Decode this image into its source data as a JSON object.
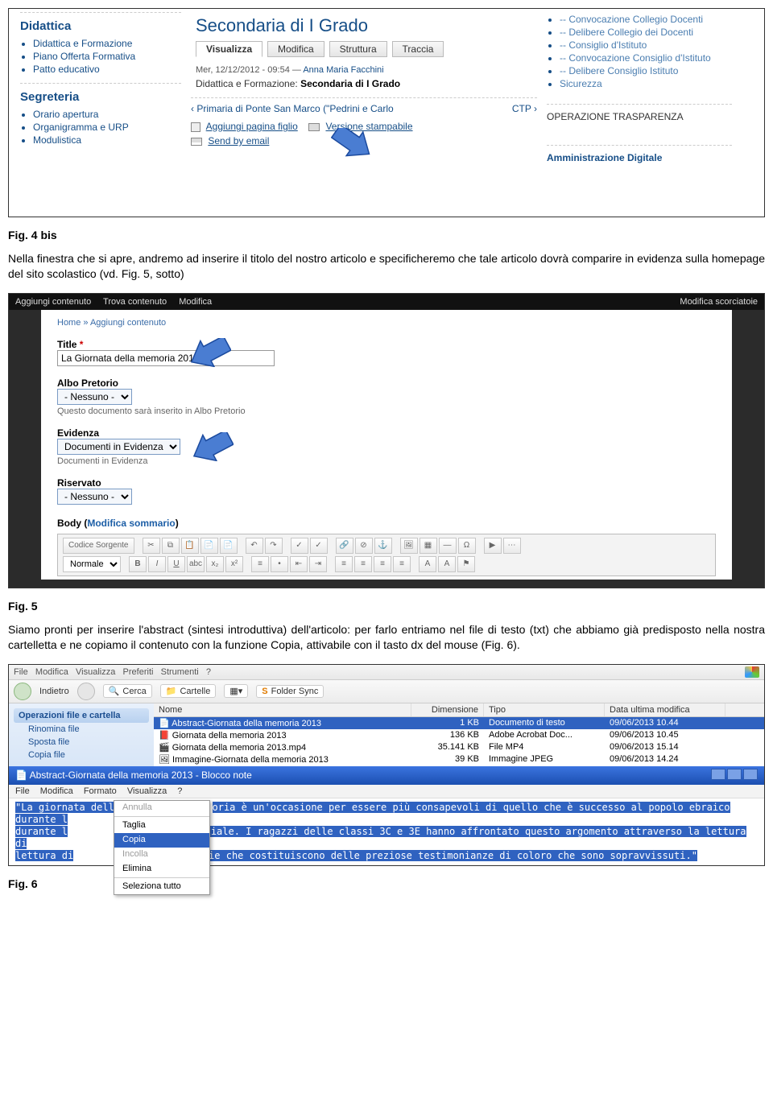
{
  "fig4": {
    "sidebar": {
      "didattica": {
        "heading": "Didattica",
        "items": [
          "Didattica e Formazione",
          "Piano Offerta Formativa",
          "Patto educativo"
        ]
      },
      "segreteria": {
        "heading": "Segreteria",
        "items": [
          "Orario apertura",
          "Organigramma e URP",
          "Modulistica"
        ]
      }
    },
    "main": {
      "title": "Secondaria di I Grado",
      "tabs": [
        "Visualizza",
        "Modifica",
        "Struttura",
        "Traccia"
      ],
      "meta_date": "Mer, 12/12/2012 - 09:54 —",
      "meta_author": "Anna Maria Facchini",
      "bread_prefix": "Didattica e Formazione:",
      "bread_bold": "Secondaria di I Grado",
      "prev": "‹ Primaria di Ponte San Marco (\"Pedrini e Carlo",
      "next": "CTP ›",
      "add_child": "Aggiungi pagina figlio",
      "print": "Versione stampabile",
      "email": "Send by email"
    },
    "right": {
      "items": [
        "-- Convocazione Collegio Docenti",
        "-- Delibere Collegio dei Docenti",
        "-- Consiglio d'Istituto",
        "-- Convocazione Consiglio d'Istituto",
        "-- Delibere Consiglio Istituto",
        "Sicurezza"
      ],
      "box1": "OPERAZIONE TRASPARENZA",
      "box2": "Amministrazione Digitale"
    }
  },
  "para1_label": "Fig. 4 bis",
  "para1": "Nella finestra che si apre, andremo ad inserire il titolo del nostro articolo e specificheremo che tale articolo dovrà comparire in evidenza sulla homepage del sito scolastico (vd. Fig. 5, sotto)",
  "fig5": {
    "topbar": {
      "items": [
        "Aggiungi contenuto",
        "Trova contenuto",
        "Modifica"
      ],
      "right": "Modifica scorciatoie"
    },
    "breadcrumb": "Home » Aggiungi contenuto",
    "labels": {
      "title": "Title",
      "albo": "Albo Pretorio",
      "albo_hint": "Questo documento sarà inserito in Albo Pretorio",
      "evidenza": "Evidenza",
      "evidenza_hint": "Documenti in Evidenza",
      "riservato": "Riservato",
      "body": "Body",
      "body_link": "Modifica sommario"
    },
    "values": {
      "title": "La Giornata della memoria 2013",
      "albo": "- Nessuno -",
      "evidenza": "Documenti in Evidenza",
      "riservato": "- Nessuno -"
    },
    "ck": {
      "src": "Codice Sorgente",
      "format": "Normale"
    }
  },
  "para2_label": "Fig. 5",
  "para2": "Siamo pronti per inserire l'abstract (sintesi introduttiva) dell'articolo: per farlo entriamo nel file di testo (txt) che abbiamo già predisposto nella nostra cartelletta e ne copiamo il contenuto con la funzione Copia, attivabile con il tasto dx del mouse (Fig. 6).",
  "fig6": {
    "menu1": [
      "File",
      "Modifica",
      "Visualizza",
      "Preferiti",
      "Strumenti",
      "?"
    ],
    "toolbar": {
      "back": "Indietro",
      "search": "Cerca",
      "folders": "Cartelle",
      "sync": "Folder Sync"
    },
    "taskpane": {
      "heading": "Operazioni file e cartella",
      "items": [
        "Rinomina file",
        "Sposta file",
        "Copia file"
      ]
    },
    "cols": [
      "Nome",
      "Dimensione",
      "Tipo",
      "Data ultima modifica"
    ],
    "rows": [
      {
        "name": "Abstract-Giornata della memoria 2013",
        "size": "1 KB",
        "type": "Documento di testo",
        "date": "09/06/2013 10.44",
        "sel": true
      },
      {
        "name": "Giornata della memoria 2013",
        "size": "136 KB",
        "type": "Adobe Acrobat Doc...",
        "date": "09/06/2013 10.45"
      },
      {
        "name": "Giornata della memoria 2013.mp4",
        "size": "35.141 KB",
        "type": "File MP4",
        "date": "09/06/2013 15.14"
      },
      {
        "name": "Immagine-Giornata della memoria 2013",
        "size": "39 KB",
        "type": "Immagine JPEG",
        "date": "09/06/2013 14.24"
      }
    ],
    "np_title": "Abstract-Giornata della memoria 2013 - Blocco note",
    "np_menu": [
      "File",
      "Modifica",
      "Formato",
      "Visualizza",
      "?"
    ],
    "np_text_a": "\"La giornata della m",
    "np_text_b": "oria è un'occasione per essere più consapevoli di quello che è successo al popolo ebraico durante l",
    "np_text_c": "rra mondiale. I ragazzi delle classi 3C e 3E hanno affrontato questo argomento attraverso la lettura di",
    "np_text_d": "i e poesie che costituiscono delle preziose testimonianze di coloro che sono sopravvissuti.\"",
    "ctx": [
      "Annulla",
      "Taglia",
      "Copia",
      "Incolla",
      "Elimina",
      "Seleziona tutto"
    ]
  },
  "para3_label": "Fig. 6"
}
